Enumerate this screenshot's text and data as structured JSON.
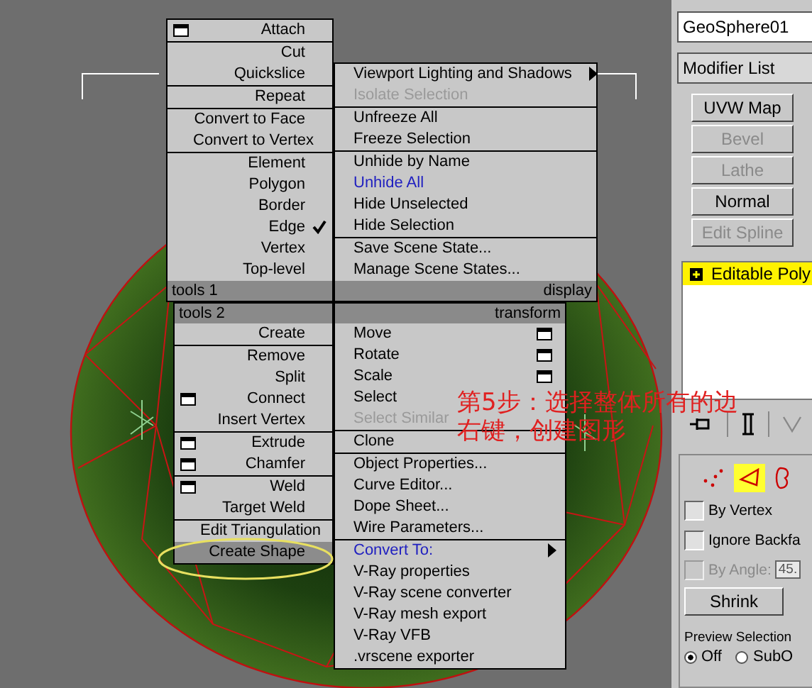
{
  "quad_menu": {
    "quadrants": [
      {
        "title": "tools 1",
        "groups": [
          [
            {
              "label": "Attach",
              "kind": "normal",
              "disabled": false,
              "checked": false,
              "options": true,
              "submenu": false,
              "selected": false
            }
          ],
          [
            {
              "label": "Cut",
              "kind": "normal",
              "disabled": false,
              "checked": false,
              "options": false,
              "submenu": false,
              "selected": false
            },
            {
              "label": "Quickslice",
              "kind": "normal",
              "disabled": false,
              "checked": false,
              "options": false,
              "submenu": false,
              "selected": false
            }
          ],
          [
            {
              "label": "Repeat",
              "kind": "normal",
              "disabled": false,
              "checked": false,
              "options": false,
              "submenu": false,
              "selected": false
            }
          ],
          [
            {
              "label": "Convert to Face",
              "kind": "normal",
              "disabled": false,
              "checked": false,
              "options": false,
              "submenu": false,
              "selected": false
            },
            {
              "label": "Convert to Vertex",
              "kind": "normal",
              "disabled": false,
              "checked": false,
              "options": false,
              "submenu": false,
              "selected": false
            }
          ],
          [
            {
              "label": "Element",
              "kind": "normal",
              "disabled": false,
              "checked": false,
              "options": false,
              "submenu": false,
              "selected": false
            },
            {
              "label": "Polygon",
              "kind": "normal",
              "disabled": false,
              "checked": false,
              "options": false,
              "submenu": false,
              "selected": false
            },
            {
              "label": "Border",
              "kind": "normal",
              "disabled": false,
              "checked": false,
              "options": false,
              "submenu": false,
              "selected": false
            },
            {
              "label": "Edge",
              "kind": "normal",
              "disabled": false,
              "checked": true,
              "options": false,
              "submenu": false,
              "selected": false
            },
            {
              "label": "Vertex",
              "kind": "normal",
              "disabled": false,
              "checked": false,
              "options": false,
              "submenu": false,
              "selected": false
            },
            {
              "label": "Top-level",
              "kind": "normal",
              "disabled": false,
              "checked": false,
              "options": false,
              "submenu": false,
              "selected": false
            }
          ]
        ]
      },
      {
        "title": "display",
        "groups": [
          [
            {
              "label": "Viewport Lighting and Shadows",
              "kind": "normal",
              "disabled": false,
              "checked": false,
              "options": false,
              "submenu": true,
              "selected": false
            },
            {
              "label": "Isolate Selection",
              "kind": "normal",
              "disabled": true,
              "checked": false,
              "options": false,
              "submenu": false,
              "selected": false
            }
          ],
          [
            {
              "label": "Unfreeze All",
              "kind": "normal",
              "disabled": false,
              "checked": false,
              "options": false,
              "submenu": false,
              "selected": false
            },
            {
              "label": "Freeze Selection",
              "kind": "normal",
              "disabled": false,
              "checked": false,
              "options": false,
              "submenu": false,
              "selected": false
            }
          ],
          [
            {
              "label": "Unhide by Name",
              "kind": "normal",
              "disabled": false,
              "checked": false,
              "options": false,
              "submenu": false,
              "selected": false
            },
            {
              "label": "Unhide All",
              "kind": "recent",
              "disabled": false,
              "checked": false,
              "options": false,
              "submenu": false,
              "selected": false
            },
            {
              "label": "Hide Unselected",
              "kind": "normal",
              "disabled": false,
              "checked": false,
              "options": false,
              "submenu": false,
              "selected": false
            },
            {
              "label": "Hide Selection",
              "kind": "normal",
              "disabled": false,
              "checked": false,
              "options": false,
              "submenu": false,
              "selected": false
            }
          ],
          [
            {
              "label": "Save Scene State...",
              "kind": "normal",
              "disabled": false,
              "checked": false,
              "options": false,
              "submenu": false,
              "selected": false
            },
            {
              "label": "Manage Scene States...",
              "kind": "normal",
              "disabled": false,
              "checked": false,
              "options": false,
              "submenu": false,
              "selected": false
            }
          ]
        ]
      },
      {
        "title": "tools 2",
        "groups": [
          [
            {
              "label": "Create",
              "kind": "normal",
              "disabled": false,
              "checked": false,
              "options": false,
              "submenu": false,
              "selected": false
            }
          ],
          [
            {
              "label": "Remove",
              "kind": "normal",
              "disabled": false,
              "checked": false,
              "options": false,
              "submenu": false,
              "selected": false
            },
            {
              "label": "Split",
              "kind": "normal",
              "disabled": false,
              "checked": false,
              "options": false,
              "submenu": false,
              "selected": false
            },
            {
              "label": "Connect",
              "kind": "normal",
              "disabled": false,
              "checked": false,
              "options": true,
              "submenu": false,
              "selected": false
            },
            {
              "label": "Insert Vertex",
              "kind": "normal",
              "disabled": false,
              "checked": false,
              "options": false,
              "submenu": false,
              "selected": false
            }
          ],
          [
            {
              "label": "Extrude",
              "kind": "normal",
              "disabled": false,
              "checked": false,
              "options": true,
              "submenu": false,
              "selected": false
            },
            {
              "label": "Chamfer",
              "kind": "normal",
              "disabled": false,
              "checked": false,
              "options": true,
              "submenu": false,
              "selected": false
            }
          ],
          [
            {
              "label": "Weld",
              "kind": "normal",
              "disabled": false,
              "checked": false,
              "options": true,
              "submenu": false,
              "selected": false
            },
            {
              "label": "Target Weld",
              "kind": "normal",
              "disabled": false,
              "checked": false,
              "options": false,
              "submenu": false,
              "selected": false
            }
          ],
          [
            {
              "label": "Edit Triangulation",
              "kind": "normal",
              "disabled": false,
              "checked": false,
              "options": false,
              "submenu": false,
              "selected": false
            },
            {
              "label": "Create Shape",
              "kind": "normal",
              "disabled": false,
              "checked": false,
              "options": false,
              "submenu": false,
              "selected": true
            }
          ]
        ]
      },
      {
        "title": "transform",
        "groups": [
          [
            {
              "label": "Move",
              "kind": "normal",
              "disabled": false,
              "checked": false,
              "options": true,
              "submenu": false,
              "selected": false
            },
            {
              "label": "Rotate",
              "kind": "normal",
              "disabled": false,
              "checked": false,
              "options": true,
              "submenu": false,
              "selected": false
            },
            {
              "label": "Scale",
              "kind": "normal",
              "disabled": false,
              "checked": false,
              "options": true,
              "submenu": false,
              "selected": false
            },
            {
              "label": "Select",
              "kind": "normal",
              "disabled": false,
              "checked": false,
              "options": false,
              "submenu": false,
              "selected": false
            },
            {
              "label": "Select Similar",
              "kind": "normal",
              "disabled": true,
              "checked": false,
              "options": false,
              "submenu": false,
              "selected": false
            }
          ],
          [
            {
              "label": "Clone",
              "kind": "normal",
              "disabled": false,
              "checked": false,
              "options": false,
              "submenu": false,
              "selected": false
            }
          ],
          [
            {
              "label": "Object Properties...",
              "kind": "normal",
              "disabled": false,
              "checked": false,
              "options": false,
              "submenu": false,
              "selected": false
            },
            {
              "label": "Curve Editor...",
              "kind": "normal",
              "disabled": false,
              "checked": false,
              "options": false,
              "submenu": false,
              "selected": false
            },
            {
              "label": "Dope Sheet...",
              "kind": "normal",
              "disabled": false,
              "checked": false,
              "options": false,
              "submenu": false,
              "selected": false
            },
            {
              "label": "Wire Parameters...",
              "kind": "normal",
              "disabled": false,
              "checked": false,
              "options": false,
              "submenu": false,
              "selected": false
            }
          ],
          [
            {
              "label": "Convert To:",
              "kind": "recent",
              "disabled": false,
              "checked": false,
              "options": false,
              "submenu": true,
              "selected": false
            },
            {
              "label": "V-Ray properties",
              "kind": "normal",
              "disabled": false,
              "checked": false,
              "options": false,
              "submenu": false,
              "selected": false
            },
            {
              "label": "V-Ray scene converter",
              "kind": "normal",
              "disabled": false,
              "checked": false,
              "options": false,
              "submenu": false,
              "selected": false
            },
            {
              "label": "V-Ray mesh export",
              "kind": "normal",
              "disabled": false,
              "checked": false,
              "options": false,
              "submenu": false,
              "selected": false
            },
            {
              "label": "V-Ray VFB",
              "kind": "normal",
              "disabled": false,
              "checked": false,
              "options": false,
              "submenu": false,
              "selected": false
            },
            {
              "label": ".vrscene exporter",
              "kind": "normal",
              "disabled": false,
              "checked": false,
              "options": false,
              "submenu": false,
              "selected": false
            }
          ]
        ]
      }
    ]
  },
  "annotation": {
    "lines": [
      "第5步：选择整体所有的边",
      "右键，创建图形"
    ]
  },
  "command_panel": {
    "object_name": "GeoSphere01",
    "modifier_list": {
      "value": "Modifier List"
    },
    "modifier_buttons": [
      {
        "label": "UVW Map",
        "disabled": false
      },
      {
        "label": "Bevel",
        "disabled": true
      },
      {
        "label": "Lathe",
        "disabled": true
      },
      {
        "label": "Normal",
        "disabled": false
      },
      {
        "label": "Edit Spline",
        "disabled": true
      }
    ],
    "stack": [
      {
        "label": "Editable Poly",
        "selected": true
      }
    ],
    "subobject_levels": [
      {
        "kind": "vertex",
        "selected": false
      },
      {
        "kind": "edge",
        "selected": true
      },
      {
        "kind": "border",
        "selected": false
      }
    ],
    "options": [
      {
        "label": "By Vertex",
        "checked": false,
        "disabled": false
      },
      {
        "label": "Ignore Backfa",
        "checked": false,
        "disabled": false
      },
      {
        "label": "By Angle:",
        "checked": false,
        "disabled": true,
        "value": "45."
      }
    ],
    "shrink_button": "Shrink",
    "preview_selection": {
      "label": "Preview Selection",
      "choices": [
        {
          "label": "Off",
          "selected": true
        },
        {
          "label": "SubO",
          "selected": false
        }
      ]
    }
  }
}
